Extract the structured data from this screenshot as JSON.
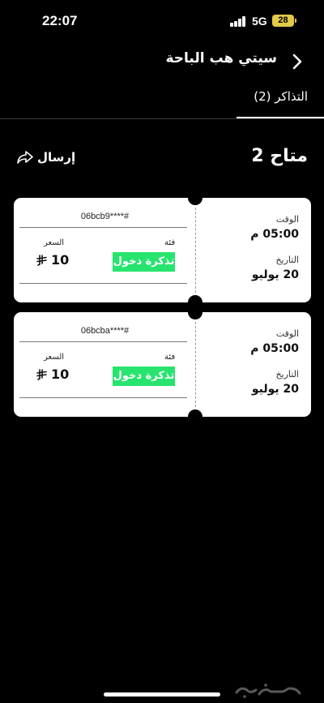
{
  "status_bar": {
    "time": "22:07",
    "network": "5G",
    "battery": "28"
  },
  "header": {
    "title": "سيتي هب الباحة"
  },
  "tabs": [
    {
      "label": "التذاكر (2)"
    }
  ],
  "section": {
    "available": "متاح 2",
    "send_label": "إرسال"
  },
  "tickets": [
    {
      "id": "06bcb9****#",
      "category_label": "فئة",
      "category_value": "تذكرة دخول",
      "price_label": "السعر",
      "price_value": "10",
      "time_label": "الوقت",
      "time_value": "05:00 م",
      "date_label": "التاريخ",
      "date_value": "20 يوليو"
    },
    {
      "id": "06bcba****#",
      "category_label": "فئة",
      "category_value": "تذكرة دخول",
      "price_label": "السعر",
      "price_value": "10",
      "time_label": "الوقت",
      "time_value": "05:00 م",
      "date_label": "التاريخ",
      "date_value": "20 يوليو"
    }
  ],
  "watermark": {
    "text": "حراج"
  },
  "colors": {
    "background": "#000000",
    "ticket": "#ffffff",
    "category_badge": "#27e46f",
    "battery": "#e2c94a"
  }
}
